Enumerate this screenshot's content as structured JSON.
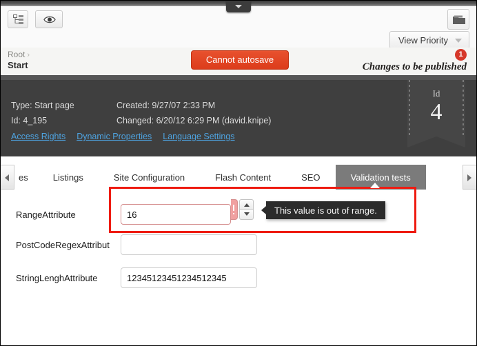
{
  "toolbar": {
    "tree_icon": "tree-structure-icon",
    "preview_icon": "eye-icon",
    "folder_icon": "folder-icon",
    "pull_tab_icon": "chevron-down-icon",
    "view_priority_label": "View Priority",
    "view_priority_chevron": "chevron-down-icon"
  },
  "breadcrumb": {
    "root": "Root",
    "separator": "›",
    "current": "Start"
  },
  "status": {
    "autosave_label": "Cannot autosave",
    "publish_note": "Changes to be published",
    "publish_badge_count": "1"
  },
  "info_panel": {
    "type_line": "Type: Start page",
    "id_line": "Id: 4_195",
    "created_line": "Created: 9/27/07 2:33 PM",
    "changed_line": "Changed: 6/20/12 6:29 PM (david.knipe)",
    "links": [
      {
        "label": "Access Rights"
      },
      {
        "label": "Dynamic Properties"
      },
      {
        "label": "Language Settings"
      }
    ],
    "ribbon": {
      "caption": "Id",
      "value": "4"
    }
  },
  "tabs": {
    "scroll_left_icon": "arrow-left-icon",
    "scroll_right_icon": "arrow-right-icon",
    "items": [
      {
        "label": "es",
        "active": false,
        "clipped": true
      },
      {
        "label": "Listings",
        "active": false,
        "clipped": false
      },
      {
        "label": "Site Configuration",
        "active": false,
        "clipped": false
      },
      {
        "label": "Flash Content",
        "active": false,
        "clipped": false
      },
      {
        "label": "SEO",
        "active": false,
        "clipped": false
      },
      {
        "label": "Validation tests",
        "active": true,
        "clipped": false
      }
    ]
  },
  "form": {
    "fields": [
      {
        "label": "RangeAttribute",
        "value": "16",
        "placeholder": "",
        "invalid": true
      },
      {
        "label": "PostCodeRegexAttribut",
        "value": "",
        "placeholder": "",
        "invalid": false
      },
      {
        "label": "StringLenghAttribute",
        "value": "12345123451234512345",
        "placeholder": "",
        "invalid": false
      }
    ],
    "spinner": {
      "up_icon": "spinner-up-icon",
      "down_icon": "spinner-down-icon"
    },
    "error_marker_icon": "exclamation-icon",
    "tooltip_text": "This value is out of range."
  },
  "colors": {
    "accent_red": "#dc3c1b",
    "highlight_red": "#ee1b11",
    "panel_dark": "#3f3f3f",
    "tab_active": "#7b7b7b",
    "link_blue": "#4ea3e0",
    "badge_red": "#d6382a"
  }
}
